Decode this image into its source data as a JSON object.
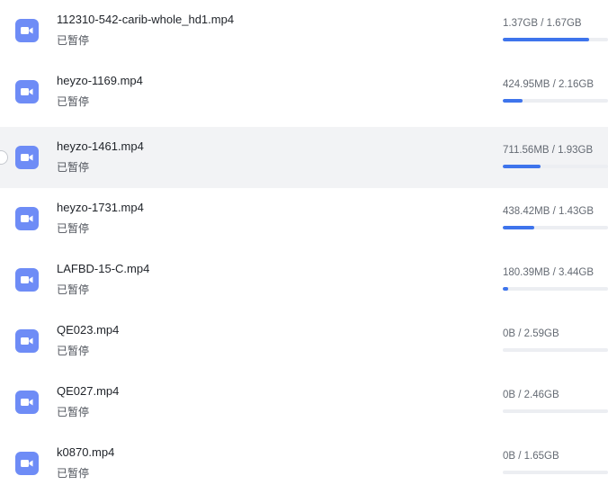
{
  "downloads": [
    {
      "name": "112310-542-carib-whole_hd1.mp4",
      "status": "已暂停",
      "size": "1.37GB / 1.67GB",
      "progress": 0.82,
      "icon": "video-file-icon"
    },
    {
      "name": "heyzo-1169.mp4",
      "status": "已暂停",
      "size": "424.95MB / 2.16GB",
      "progress": 0.19,
      "icon": "video-file-icon"
    },
    {
      "name": "heyzo-1461.mp4",
      "status": "已暂停",
      "size": "711.56MB / 1.93GB",
      "progress": 0.36,
      "icon": "video-file-icon",
      "hovered": true
    },
    {
      "name": "heyzo-1731.mp4",
      "status": "已暂停",
      "size": "438.42MB / 1.43GB",
      "progress": 0.3,
      "icon": "video-file-icon"
    },
    {
      "name": "LAFBD-15-C.mp4",
      "status": "已暂停",
      "size": "180.39MB / 3.44GB",
      "progress": 0.05,
      "icon": "video-file-icon"
    },
    {
      "name": "QE023.mp4",
      "status": "已暂停",
      "size": "0B / 2.59GB",
      "progress": 0,
      "icon": "video-file-icon"
    },
    {
      "name": "QE027.mp4",
      "status": "已暂停",
      "size": "0B / 2.46GB",
      "progress": 0,
      "icon": "video-file-icon"
    },
    {
      "name": "k0870.mp4",
      "status": "已暂停",
      "size": "0B / 1.65GB",
      "progress": 0,
      "icon": "video-file-icon"
    }
  ],
  "colors": {
    "accent": "#3e74ec",
    "icon_bg": "#6e8cf6",
    "hover_bg": "#f2f3f5",
    "track": "#eceef2"
  }
}
